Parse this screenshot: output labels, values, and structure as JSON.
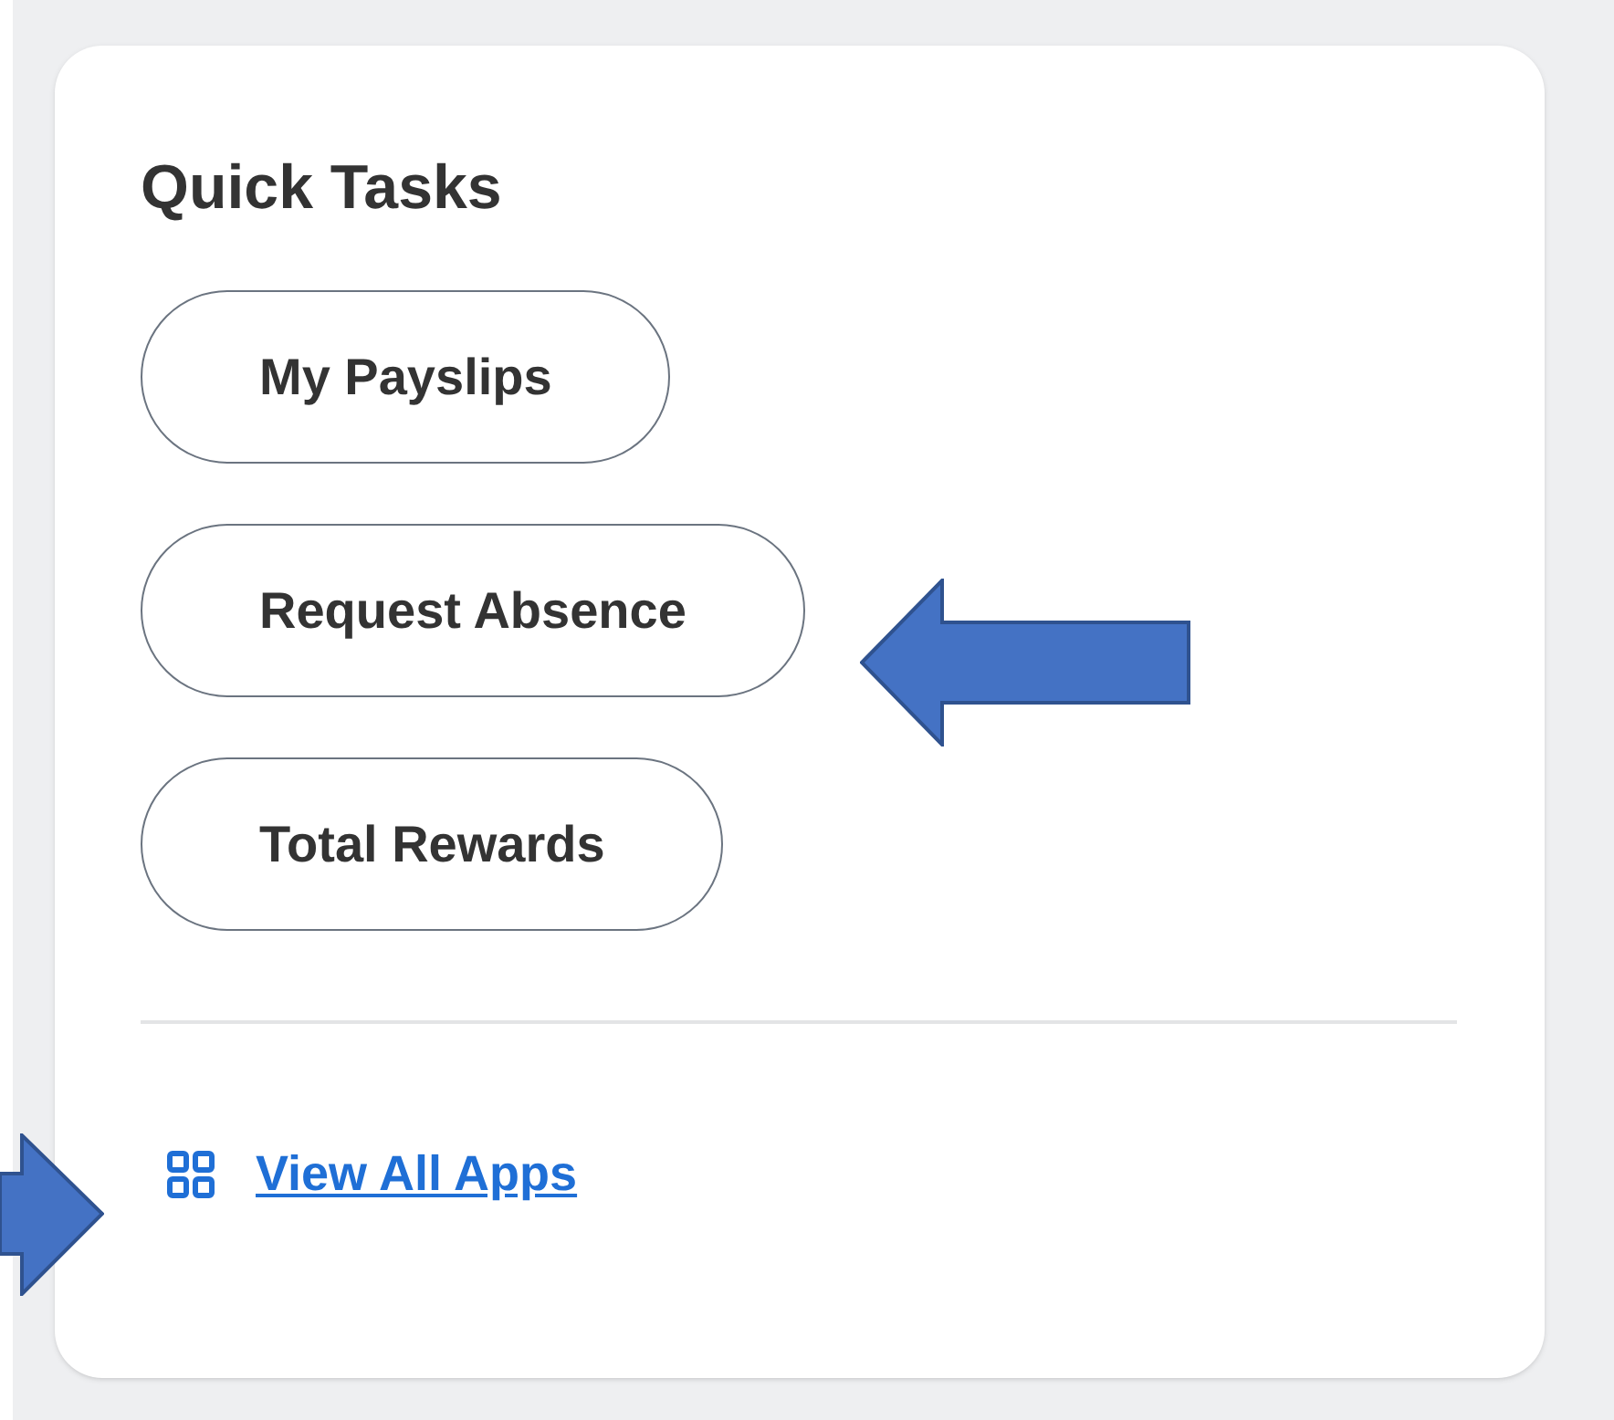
{
  "card": {
    "title": "Quick Tasks",
    "tasks": [
      {
        "label": "My Payslips"
      },
      {
        "label": "Request Absence"
      },
      {
        "label": "Total Rewards"
      }
    ],
    "footer_link": {
      "label": "View All Apps"
    }
  }
}
